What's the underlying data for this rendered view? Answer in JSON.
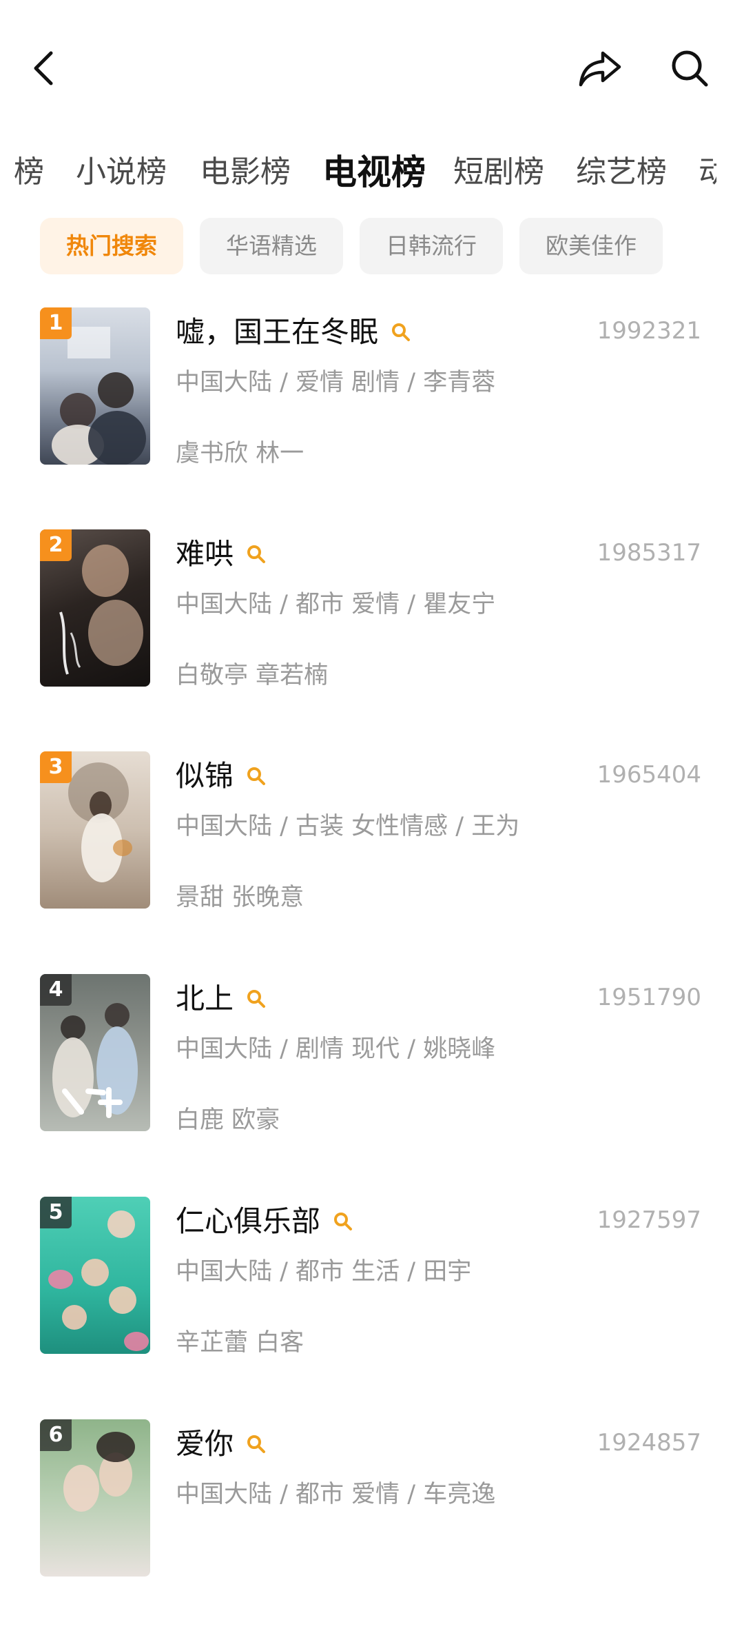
{
  "tabs": [
    "榜",
    "小说榜",
    "电影榜",
    "电视榜",
    "短剧榜",
    "综艺榜",
    "动"
  ],
  "active_tab_index": 3,
  "chips": [
    "热门搜索",
    "华语精选",
    "日韩流行",
    "欧美佳作"
  ],
  "active_chip_index": 0,
  "colors": {
    "accent": "#f6901d",
    "chip_active_bg": "#fff3e6",
    "muted_text": "#9a9a9a"
  },
  "items": [
    {
      "rank": "1",
      "title": "嘘，国王在冬眠",
      "score": "1992321",
      "meta": "中国大陆 / 爱情 剧情 / 李青蓉",
      "cast": "虞书欣 林一"
    },
    {
      "rank": "2",
      "title": "难哄",
      "score": "1985317",
      "meta": "中国大陆 / 都市 爱情 / 瞿友宁",
      "cast": "白敬亭 章若楠"
    },
    {
      "rank": "3",
      "title": "似锦",
      "score": "1965404",
      "meta": "中国大陆 / 古装 女性情感 / 王为",
      "cast": "景甜 张晚意"
    },
    {
      "rank": "4",
      "title": "北上",
      "score": "1951790",
      "meta": "中国大陆 / 剧情 现代 / 姚晓峰",
      "cast": "白鹿 欧豪"
    },
    {
      "rank": "5",
      "title": "仁心俱乐部",
      "score": "1927597",
      "meta": "中国大陆 / 都市 生活 / 田宇",
      "cast": "辛芷蕾 白客"
    },
    {
      "rank": "6",
      "title": "爱你",
      "score": "1924857",
      "meta": "中国大陆 / 都市 爱情 / 车亮逸",
      "cast": ""
    }
  ]
}
